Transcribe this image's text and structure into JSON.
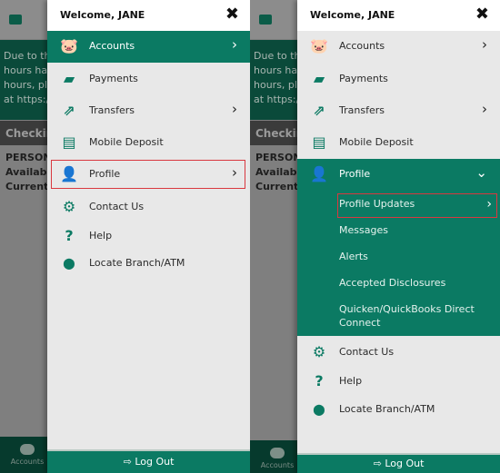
{
  "colors": {
    "brand_green": "#0b7a63",
    "drawer_bg": "#e8e8e8",
    "highlight_outline": "#d9383f"
  },
  "background": {
    "notice_lines": [
      "Due to the",
      "hours have",
      "hours, ple",
      "at https:/"
    ],
    "section": "Checking",
    "account_lines": [
      "PERSONA",
      "Available",
      "Current B"
    ],
    "tab_label": "Accounts"
  },
  "header": {
    "welcome": "Welcome, JANE",
    "close_icon": "close-icon"
  },
  "menu": [
    {
      "label": "Accounts",
      "icon": "piggy-bank-icon",
      "chevron": true
    },
    {
      "label": "Payments",
      "icon": "wallet-icon",
      "chevron": false
    },
    {
      "label": "Transfers",
      "icon": "transfer-icon",
      "chevron": true
    },
    {
      "label": "Mobile Deposit",
      "icon": "mobile-deposit-icon",
      "chevron": false
    },
    {
      "label": "Profile",
      "icon": "user-gear-icon",
      "chevron": true
    },
    {
      "label": "Contact Us",
      "icon": "gears-icon",
      "chevron": false
    },
    {
      "label": "Help",
      "icon": "help-icon",
      "chevron": false
    },
    {
      "label": "Locate Branch/ATM",
      "icon": "map-pin-icon",
      "chevron": false
    }
  ],
  "profile_submenu": [
    {
      "label": "Profile Updates",
      "chevron": true
    },
    {
      "label": "Messages"
    },
    {
      "label": "Alerts"
    },
    {
      "label": "Accepted Disclosures"
    },
    {
      "label": "Quicken/QuickBooks Direct Connect"
    }
  ],
  "screens": [
    {
      "active_item": "Accounts",
      "highlighted": "Profile",
      "expanded": false
    },
    {
      "active_item": "Profile",
      "highlighted": "Profile Updates",
      "expanded": true
    }
  ],
  "logout_label": "Log Out"
}
